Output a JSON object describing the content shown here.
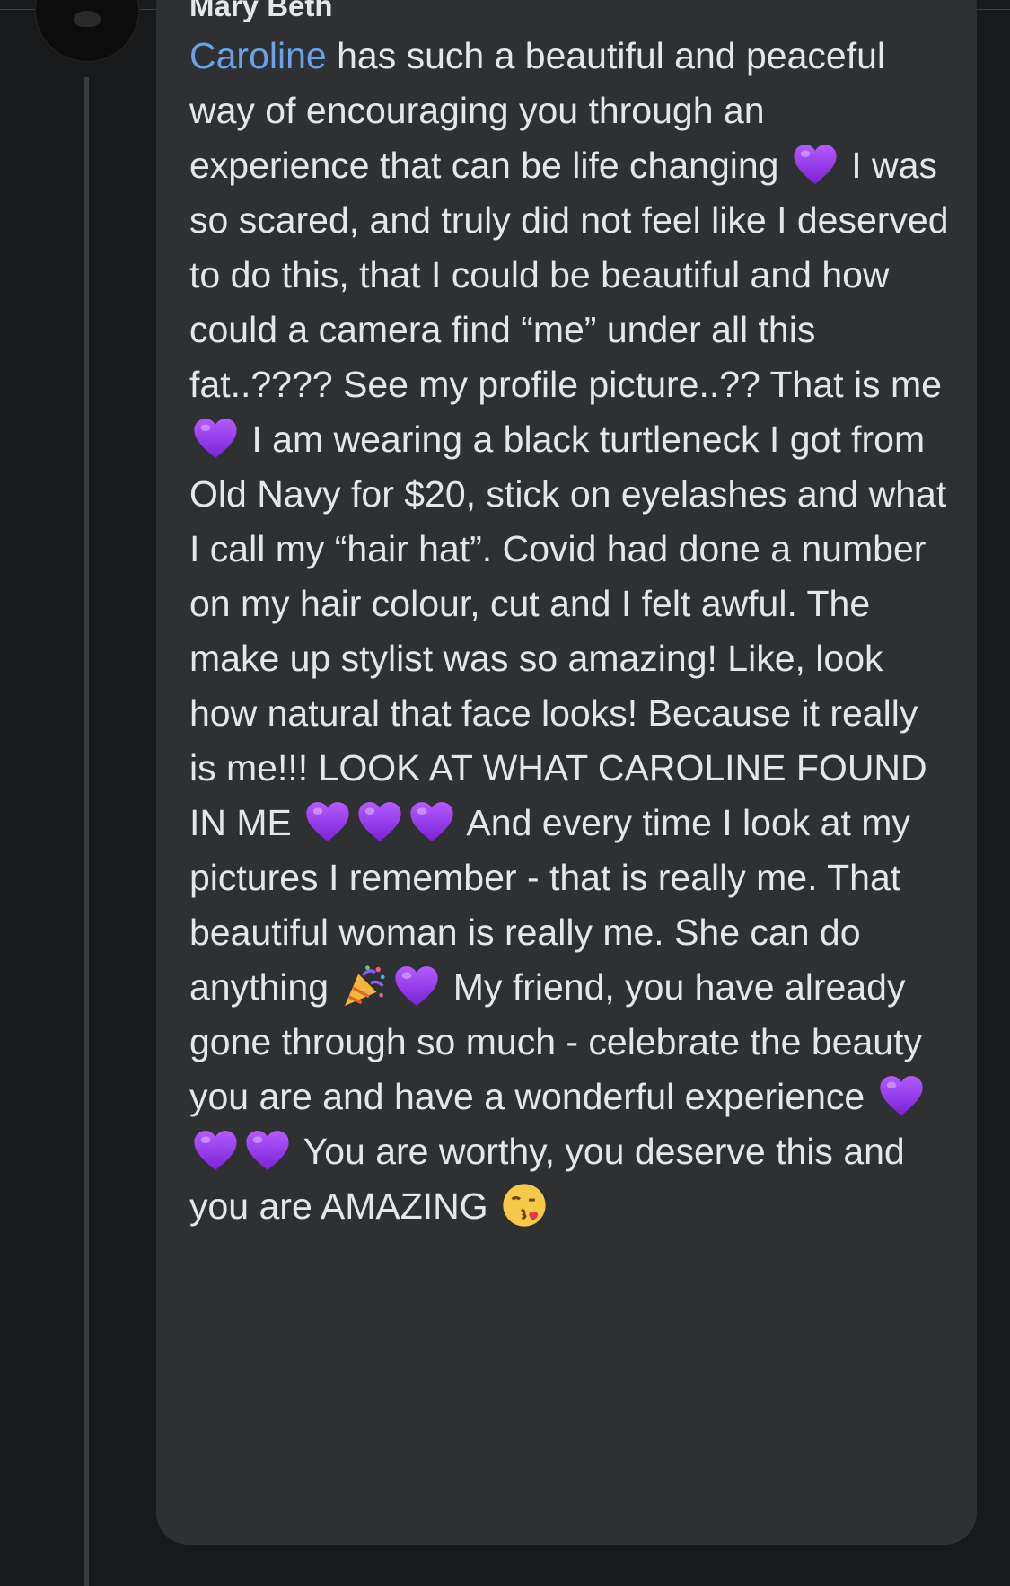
{
  "post": {
    "author": "Mary Beth",
    "mention": "Caroline",
    "segments": [
      " has such a beautiful and peaceful way of encouraging you through an experience that can be life changing ",
      " I was so scared, and truly did not feel like I deserved to do this, that I could be beautiful and how could a camera find “me” under all this fat..???? See my profile picture..?? That is me ",
      " I am wearing a black turtleneck I got from Old Navy for $20, stick on eyelashes and what I call my “hair hat”. Covid had done a number on my hair colour, cut and I felt awful. The make up stylist was so amazing! Like, look how natural that face looks! Because it really is me!!! LOOK AT WHAT CAROLINE FOUND IN ME ",
      " And every time I look at my pictures I remember - that is really me. That beautiful woman is really me. She can do anything ",
      " My friend, you have already gone through so much - celebrate the beauty you are and have a wonderful experience ",
      " You are worthy, you deserve this and you are AMAZING "
    ]
  },
  "icons": {
    "heart": "purple-heart-icon",
    "party": "party-popper-icon",
    "kiss": "face-blowing-kiss-icon"
  },
  "colors": {
    "background": "#18191a",
    "bubble": "#2f3031",
    "text": "#e4e6eb",
    "mention": "#6aa0ec",
    "heart": "#8e2de2"
  }
}
